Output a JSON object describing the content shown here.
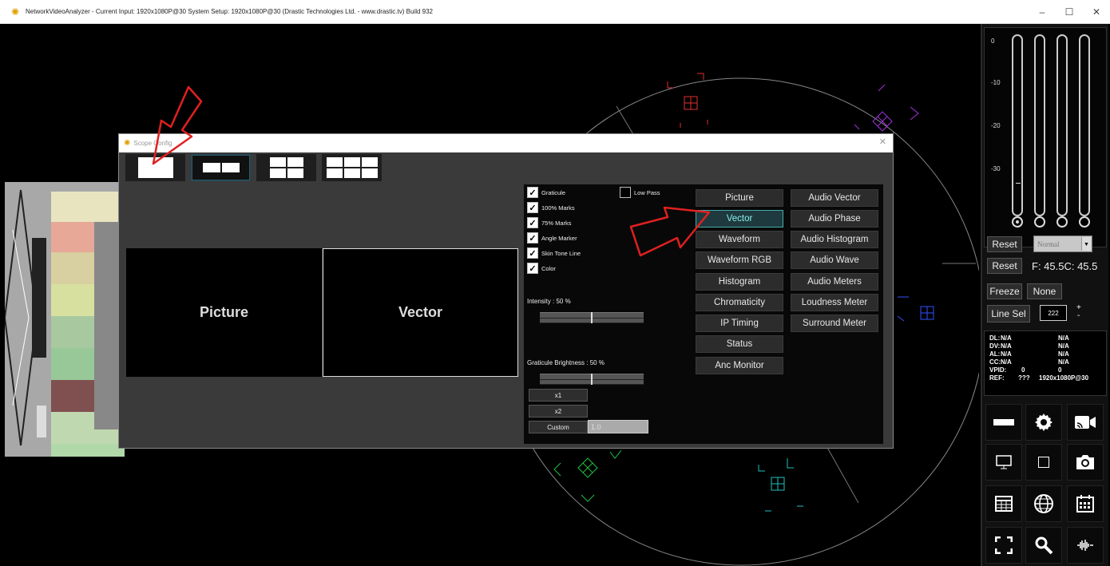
{
  "window": {
    "title": "NetworkVideoAnalyzer -  Current Input: 1920x1080P@30  System Setup: 1920x1080P@30    (Drastic Technologies Ltd. - www.drastic.tv) Build 932",
    "minimize": "–",
    "maximize": "☐",
    "close": "✕"
  },
  "dialog": {
    "title": "Scope Config",
    "close": "✕",
    "panes": [
      "Picture",
      "Vector"
    ],
    "checkboxes": [
      {
        "label": "Graticule",
        "checked": true
      },
      {
        "label": "100% Marks",
        "checked": true
      },
      {
        "label": "75% Marks",
        "checked": true
      },
      {
        "label": "Angle Marker",
        "checked": true
      },
      {
        "label": "Skin Tone Line",
        "checked": true
      },
      {
        "label": "Color",
        "checked": true
      }
    ],
    "low_pass": {
      "label": "Low Pass",
      "checked": false
    },
    "intensity_label": "Intensity : 50 %",
    "intensity_value": 0.5,
    "graticule_label": "Graticule Brightness : 50 %",
    "graticule_value": 0.5,
    "zoom_buttons": [
      "x1",
      "x2",
      "Custom"
    ],
    "custom_value": "1.0",
    "scopes_left": [
      "Picture",
      "Vector",
      "Waveform",
      "Waveform RGB",
      "Histogram",
      "Chromaticity",
      "IP Timing",
      "Status",
      "Anc Monitor"
    ],
    "scopes_right": [
      "Audio Vector",
      "Audio Phase",
      "Audio Histogram",
      "Audio Wave",
      "Audio Meters",
      "Loudness Meter",
      "Surround Meter"
    ],
    "selected_scope": "Vector"
  },
  "right_panel": {
    "meter_scale": [
      "0",
      "-10",
      "-20",
      "-30"
    ],
    "reset1": "Reset",
    "mode_select": "Normal",
    "reset2": "Reset",
    "fc_readout": "F: 45.5C: 45.5",
    "freeze": "Freeze",
    "none": "None",
    "line_sel": "Line Sel",
    "line_value": "222",
    "plus": "+",
    "minus": "-",
    "status": [
      {
        "k": "DL:",
        "a": "N/A",
        "b": "N/A"
      },
      {
        "k": "DV:",
        "a": "N/A",
        "b": "N/A"
      },
      {
        "k": "AL:",
        "a": "N/A",
        "b": "N/A"
      },
      {
        "k": "CC:",
        "a": "N/A",
        "b": "N/A"
      },
      {
        "k": "VPID:",
        "a": "0",
        "b": "0"
      },
      {
        "k": "REF:",
        "a": "???",
        "b": "1920x1080P@30"
      }
    ]
  },
  "colors": {
    "accent": "#44aaaa",
    "arrow": "#e02020",
    "vector_red": "#e03030",
    "vector_magenta": "#a030e0",
    "vector_green": "#20c040",
    "vector_cyan": "#20c0c0",
    "vector_blue": "#3050ff"
  }
}
